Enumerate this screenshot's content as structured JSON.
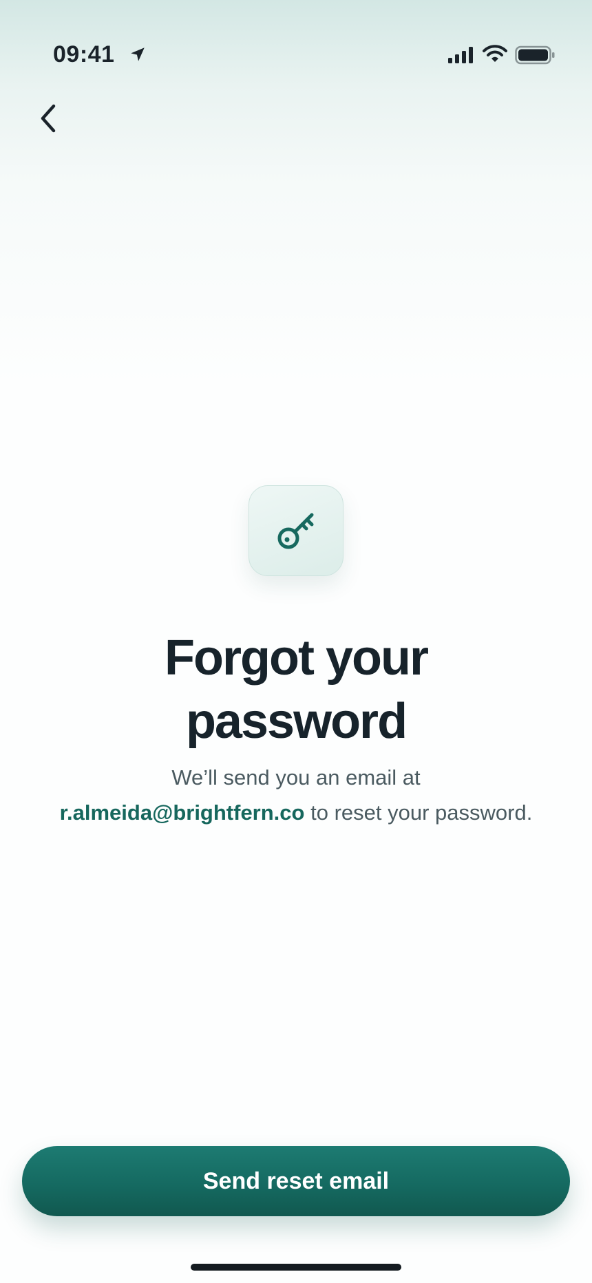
{
  "status_bar": {
    "time": "09:41",
    "icons": [
      "location-arrow-icon",
      "cellular-signal-icon",
      "wifi-icon",
      "battery-icon"
    ]
  },
  "navigation": {
    "back_icon": "chevron-left-icon"
  },
  "hero": {
    "icon": "key-icon",
    "title_line1": "Forgot your",
    "title_line2": "password",
    "subtitle_prefix": "We’ll send you an email at",
    "email": "r.almeida@brightfern.co",
    "subtitle_suffix": "to reset your password."
  },
  "actions": {
    "send_label": "Send reset email"
  },
  "colors": {
    "accent": "#17695f",
    "text_primary": "#17232b",
    "text_secondary": "#4a5a60",
    "background_top": "#d3e7e4"
  }
}
